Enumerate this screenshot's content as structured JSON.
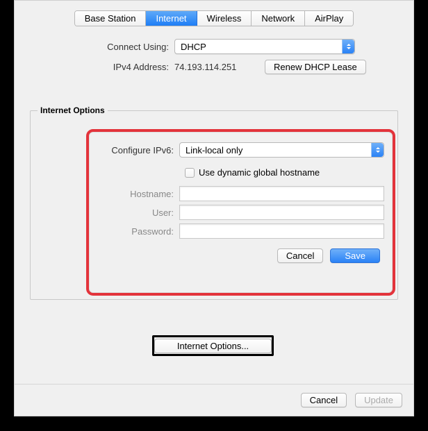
{
  "tabs": {
    "base_station": "Base Station",
    "internet": "Internet",
    "wireless": "Wireless",
    "network": "Network",
    "airplay": "AirPlay"
  },
  "connect": {
    "label": "Connect Using:",
    "value": "DHCP"
  },
  "ipv4": {
    "label": "IPv4 Address:",
    "value": "74.193.114.251",
    "renew": "Renew DHCP Lease"
  },
  "group": {
    "title": "Internet Options"
  },
  "sheet": {
    "configure_label": "Configure IPv6:",
    "configure_value": "Link-local only",
    "dynamic_hostname": "Use dynamic global hostname",
    "hostname_label": "Hostname:",
    "user_label": "User:",
    "password_label": "Password:",
    "cancel": "Cancel",
    "save": "Save"
  },
  "options_button": "Internet Options...",
  "bottom": {
    "cancel": "Cancel",
    "update": "Update"
  }
}
